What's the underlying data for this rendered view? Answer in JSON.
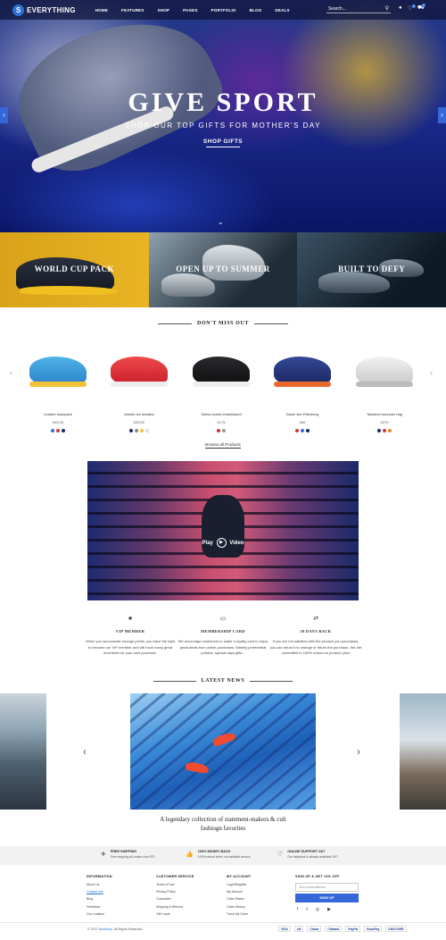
{
  "header": {
    "logo_badge": "S",
    "logo_text": "EVERYTHING",
    "nav": [
      "HOME",
      "FEATURES",
      "SHOP",
      "PAGES",
      "PORTFOLIO",
      "BLOG",
      "DEALS"
    ],
    "search_placeholder": "Search...",
    "cart_count": "0",
    "wishlist_count": "0"
  },
  "hero": {
    "title": "GIVE SPORT",
    "subtitle": "SHOP OUR TOP GIFTS FOR MOTHER'S DAY",
    "button": "SHOP GIFTS"
  },
  "banners": [
    "WORLD CUP PACK",
    "OPEN UP TO SUMMER",
    "BUILT TO DEFY"
  ],
  "products_section": {
    "title": "DON'T MISS OUT",
    "items": [
      {
        "name": "Leather backpack",
        "price": "£45.00",
        "colors": [
          "#2f6fd8",
          "#d9342b",
          "#1a2a6a"
        ]
      },
      {
        "name": "Amelie Ice detailes",
        "price": "£25.00",
        "colors": [
          "#1a2a6a",
          "#8a8a8a",
          "#e8c040",
          "#ffffff"
        ]
      },
      {
        "name": "Selina eyelet embellished",
        "price": "£175",
        "colors": [
          "#d9342b",
          "#9a9a9a"
        ]
      },
      {
        "name": "Diane sire Effenberg",
        "price": "£80",
        "colors": [
          "#d9342b",
          "#2f6fd8",
          "#1a2a6a"
        ]
      },
      {
        "name": "Tasseled shoulder bag",
        "price": "£270",
        "colors": [
          "#1a2a6a",
          "#d9342b",
          "#e08a2a"
        ]
      }
    ],
    "browse_link": "Browse all Products"
  },
  "video": {
    "play_label": "Play",
    "video_label": "Video"
  },
  "features": [
    {
      "icon": "star-icon",
      "title": "VIP MEMBER",
      "desc": "When you accumulate enough points, you have the right to become our VIP member and will have many great incentives for your next purchase."
    },
    {
      "icon": "card-icon",
      "title": "MEMBERSHIP CARD",
      "desc": "We encourage customers to make a loyalty card to enjoy great deals from online purchases. Weekly preferential policies, special days gifts..."
    },
    {
      "icon": "return-icon",
      "title": "30 DAYS BACK",
      "desc": "If you are not satisfied with the product you purchased, you can return it to change or return the purchase. We are committed to 100% refund on product price"
    }
  ],
  "news": {
    "title": "LATEST NEWS",
    "caption": "A legendary collection of statement-makers & cult fashiogn favorites"
  },
  "services": [
    {
      "icon": "plane-icon",
      "title": "FREE SHIPPING",
      "desc": "Free shipping all orders over $79"
    },
    {
      "icon": "thumb-icon",
      "title": "100% MONEY BACK",
      "desc": "100% refund when not satisfied service"
    },
    {
      "icon": "heart-icon",
      "title": "ONLINE SUPPORT 24/7",
      "desc": "Our helpdesk is always available 24/7"
    }
  ],
  "footer": {
    "information": {
      "title": "INFORMATION",
      "links": [
        "About Us",
        "Contact Info",
        "Blog",
        "Feedback",
        "Our Location"
      ],
      "active": 1
    },
    "customer": {
      "title": "CUSTOMER SERVICE",
      "links": [
        "Terms of Use",
        "Privacy Policy",
        "Guarantee",
        "Shipping & Returns",
        "Gift Cards"
      ]
    },
    "account": {
      "title": "MY ACCOUNT",
      "links": [
        "Login/Register",
        "My Account",
        "Order Status",
        "Order History",
        "Track My Order"
      ]
    },
    "newsletter": {
      "title": "SIGN UP & GET 10% OFF",
      "placeholder": "Your email address",
      "button": "SIGN UP"
    },
    "copyright_prefix": "© 2017",
    "copyright_brand": "MeaShop",
    "copyright_suffix": ". All Rights Reserved.",
    "payments": [
      "VISA",
      "citi",
      "Chase",
      "Citibank",
      "PayPal",
      "RushPay",
      "DISCOVER"
    ]
  }
}
